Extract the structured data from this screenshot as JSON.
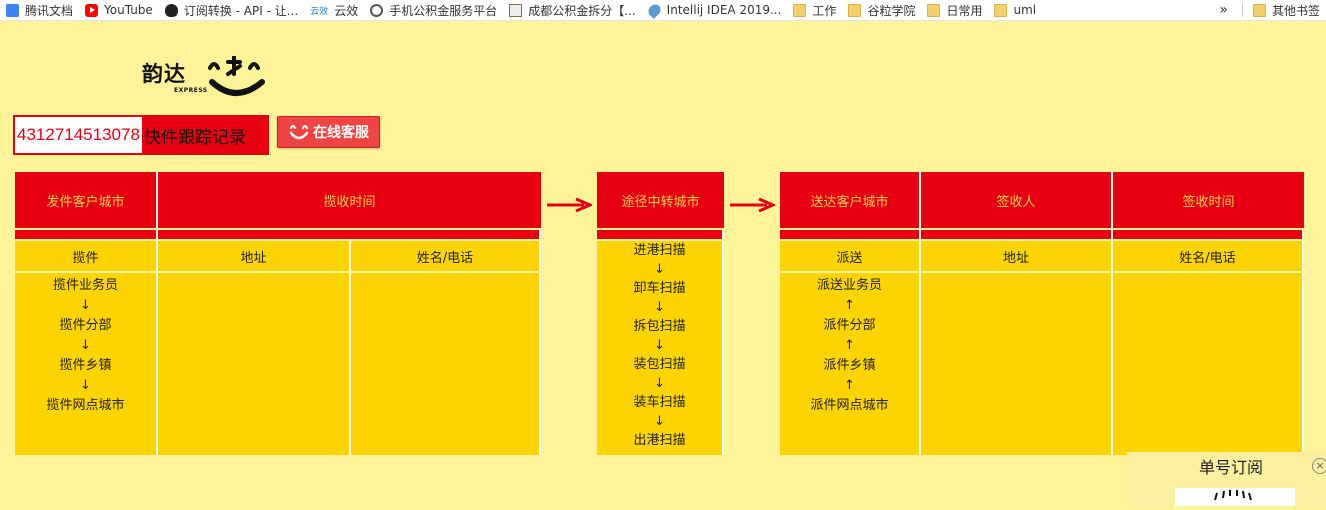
{
  "bookmarks": [
    {
      "label": "腾讯文档",
      "icon": "tencent-docs-icon"
    },
    {
      "label": "YouTube",
      "icon": "youtube-icon"
    },
    {
      "label": "订阅转换 - API - 让...",
      "icon": "api-icon"
    },
    {
      "label": "云效",
      "icon": "cloud-icon",
      "icon_text": "云效"
    },
    {
      "label": "手机公积金服务平台",
      "icon": "globe-icon"
    },
    {
      "label": "成都公积金拆分【...",
      "icon": "image-icon"
    },
    {
      "label": "Intellij IDEA 2019...",
      "icon": "location-pin-icon"
    },
    {
      "label": "工作",
      "icon": "folder-icon"
    },
    {
      "label": "谷粒学院",
      "icon": "folder-icon"
    },
    {
      "label": "日常用",
      "icon": "folder-icon"
    },
    {
      "label": "uml",
      "icon": "folder-icon"
    }
  ],
  "bookmarks_more": "»",
  "bookmarks_other": "其他书签",
  "logo": {
    "name": "韵达",
    "sub": "EXPRESS",
    "color": "#111111"
  },
  "tracking": {
    "number": "4312714513078",
    "label": "快件跟踪记录"
  },
  "customer_service": {
    "label": "在线客服"
  },
  "colors": {
    "red": "#e60012",
    "yellow": "#fcd400",
    "background": "#fdf49a"
  },
  "table_pickup": {
    "headers": [
      "发件客户城市",
      "揽收时间"
    ],
    "sub_headers": [
      "揽件",
      "地址",
      "姓名/电话"
    ],
    "flow": [
      "揽件业务员",
      "↓",
      "揽件分部",
      "↓",
      "揽件乡镇",
      "↓",
      "揽件网点城市"
    ]
  },
  "table_transit": {
    "headers": [
      "途径中转城市"
    ],
    "flow": [
      "进港扫描",
      "↓",
      "卸车扫描",
      "↓",
      "拆包扫描",
      "↓",
      "装包扫描",
      "↓",
      "装车扫描",
      "↓",
      "出港扫描"
    ]
  },
  "table_delivery": {
    "headers": [
      "送达客户城市",
      "签收人",
      "签收时间"
    ],
    "sub_headers": [
      "派送",
      "地址",
      "姓名/电话"
    ],
    "flow": [
      "派送业务员",
      "↑",
      "派件分部",
      "↑",
      "派件乡镇",
      "↑",
      "派件网点城市"
    ]
  },
  "subscribe": {
    "title": "单号订阅",
    "close": "×"
  }
}
